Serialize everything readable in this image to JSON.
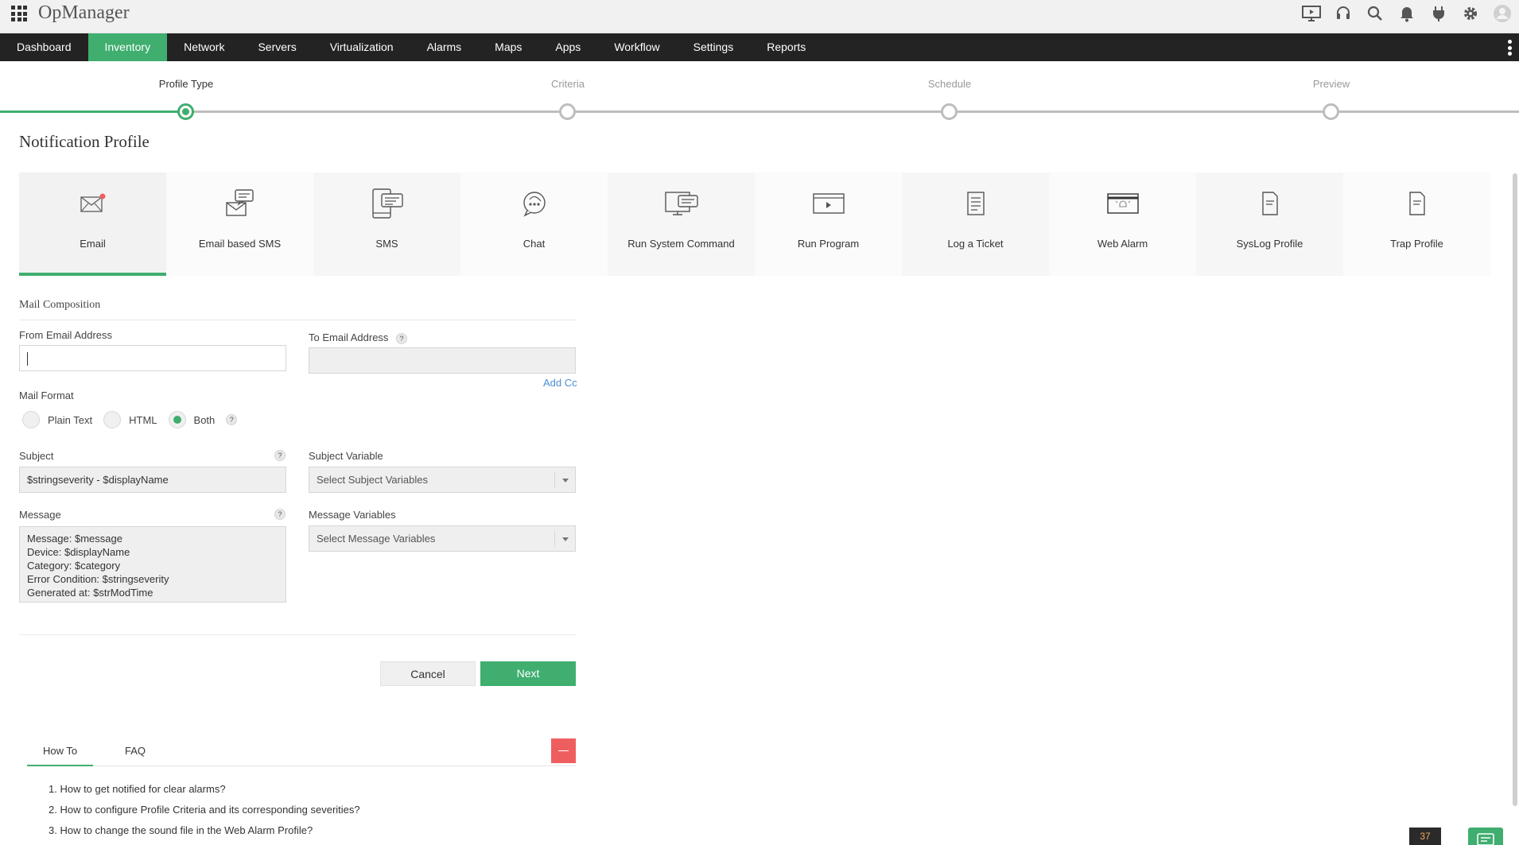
{
  "app": {
    "title": "OpManager"
  },
  "nav": {
    "items": [
      {
        "label": "Dashboard"
      },
      {
        "label": "Inventory"
      },
      {
        "label": "Network"
      },
      {
        "label": "Servers"
      },
      {
        "label": "Virtualization"
      },
      {
        "label": "Alarms"
      },
      {
        "label": "Maps"
      },
      {
        "label": "Apps"
      },
      {
        "label": "Workflow"
      },
      {
        "label": "Settings"
      },
      {
        "label": "Reports"
      }
    ],
    "active": "Inventory"
  },
  "top_icons": [
    "presentation-icon",
    "headset-icon",
    "search-icon",
    "bell-icon",
    "plug-icon",
    "gear-icon",
    "user-avatar-icon"
  ],
  "stepper": {
    "steps": [
      {
        "label": "Profile Type"
      },
      {
        "label": "Criteria"
      },
      {
        "label": "Schedule"
      },
      {
        "label": "Preview"
      }
    ],
    "current": "Profile Type"
  },
  "page": {
    "title": "Notification Profile"
  },
  "profile_types": {
    "items": [
      {
        "label": "Email",
        "icon": "email-icon"
      },
      {
        "label": "Email based SMS",
        "icon": "email-sms-icon"
      },
      {
        "label": "SMS",
        "icon": "sms-icon"
      },
      {
        "label": "Chat",
        "icon": "chat-icon"
      },
      {
        "label": "Run System Command",
        "icon": "system-command-icon"
      },
      {
        "label": "Run Program",
        "icon": "run-program-icon"
      },
      {
        "label": "Log a Ticket",
        "icon": "ticket-icon"
      },
      {
        "label": "Web Alarm",
        "icon": "web-alarm-icon"
      },
      {
        "label": "SysLog Profile",
        "icon": "syslog-icon"
      },
      {
        "label": "Trap Profile",
        "icon": "trap-icon"
      }
    ],
    "selected": "Email"
  },
  "form": {
    "section_title": "Mail Composition",
    "from_email": {
      "label": "From Email Address",
      "value": ""
    },
    "to_email": {
      "label": "To Email Address",
      "help": "?",
      "value": ""
    },
    "add_cc": "Add Cc",
    "mail_format": {
      "label": "Mail Format",
      "options": [
        "Plain Text",
        "HTML",
        "Both"
      ],
      "selected": "Both",
      "help": "?"
    },
    "subject": {
      "label": "Subject",
      "help": "?",
      "value": "$stringseverity - $displayName"
    },
    "subject_variable": {
      "label": "Subject Variable",
      "placeholder": "Select Subject Variables"
    },
    "message": {
      "label": "Message",
      "help": "?",
      "lines": [
        "Message: $message",
        "Device: $displayName",
        "Category: $category",
        "Error Condition: $stringseverity",
        "Generated at: $strModTime"
      ]
    },
    "message_variables": {
      "label": "Message Variables",
      "placeholder": "Select Message Variables"
    },
    "cancel_label": "Cancel",
    "next_label": "Next"
  },
  "help_panel": {
    "tabs": [
      "How To",
      "FAQ"
    ],
    "active_tab": "How To",
    "items": [
      "1. How to get notified for clear alarms?",
      "2. How to configure Profile Criteria and its corresponding severities?",
      "3. How to change the sound file in the Web Alarm Profile?"
    ]
  },
  "footer": {
    "badge_count": "37"
  },
  "colors": {
    "accent": "#3fae6f",
    "nav_bg": "#232323",
    "link": "#4a8fd4",
    "danger": "#ef5e5e"
  }
}
